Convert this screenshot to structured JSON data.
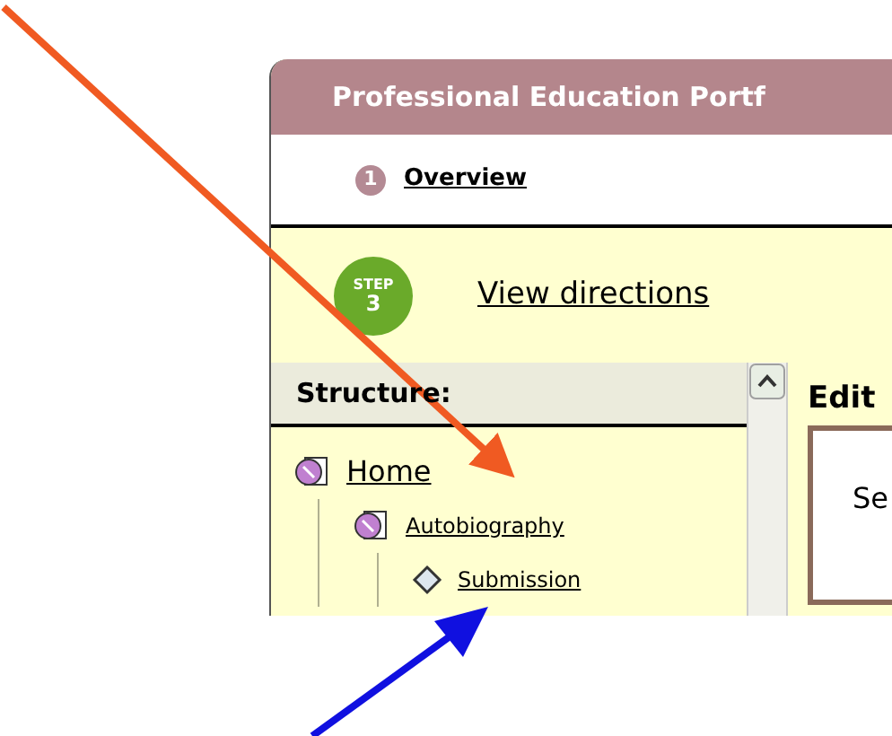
{
  "window": {
    "title": "Professional Education Portf"
  },
  "overview": {
    "number": "1",
    "label": "Overview"
  },
  "step": {
    "label": "STEP",
    "number": "3",
    "link": "View directions"
  },
  "structure": {
    "title": "Structure:",
    "tree": [
      {
        "label": "Home",
        "kind": "page",
        "children": [
          {
            "label": "Autobiography",
            "kind": "page",
            "children": [
              {
                "label": "Submission",
                "kind": "item"
              }
            ]
          }
        ]
      }
    ]
  },
  "edit": {
    "title": "Edit",
    "text": "Se"
  }
}
